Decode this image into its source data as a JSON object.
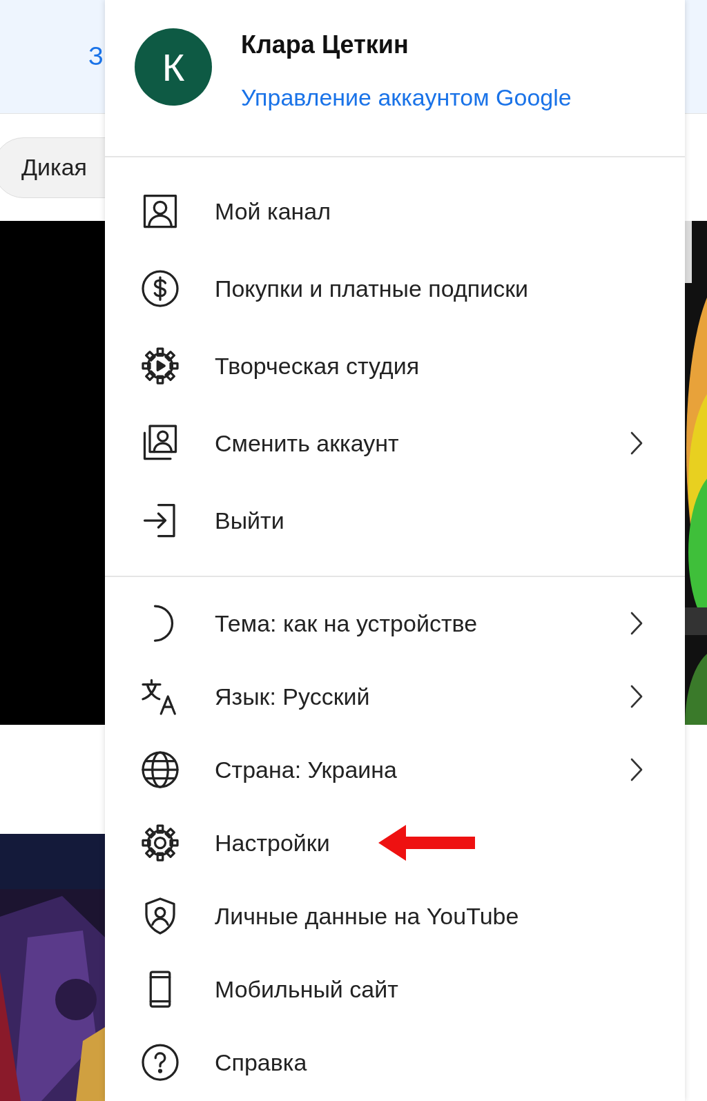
{
  "background": {
    "header_letter": "З",
    "chip": "Дикая"
  },
  "account": {
    "avatar_letter": "К",
    "name": "Клара Цеткин",
    "manage_link": "Управление аккаунтом Google"
  },
  "menu_sections": [
    {
      "items": [
        {
          "label": "Мой канал",
          "submenu": false,
          "marked": false
        },
        {
          "label": "Покупки и платные подписки",
          "submenu": false,
          "marked": false
        },
        {
          "label": "Творческая студия",
          "submenu": false,
          "marked": false
        },
        {
          "label": "Сменить аккаунт",
          "submenu": true,
          "marked": false
        },
        {
          "label": "Выйти",
          "submenu": false,
          "marked": false
        }
      ]
    },
    {
      "items": [
        {
          "label": "Тема: как на устройстве",
          "submenu": true,
          "marked": false
        },
        {
          "label": "Язык: Русский",
          "submenu": true,
          "marked": false
        },
        {
          "label": "Страна: Украина",
          "submenu": true,
          "marked": false
        },
        {
          "label": "Настройки",
          "submenu": false,
          "marked": true
        },
        {
          "label": "Личные данные на YouTube",
          "submenu": false,
          "marked": false
        },
        {
          "label": "Мобильный сайт",
          "submenu": false,
          "marked": false
        },
        {
          "label": "Справка",
          "submenu": false,
          "marked": false
        }
      ]
    }
  ]
}
